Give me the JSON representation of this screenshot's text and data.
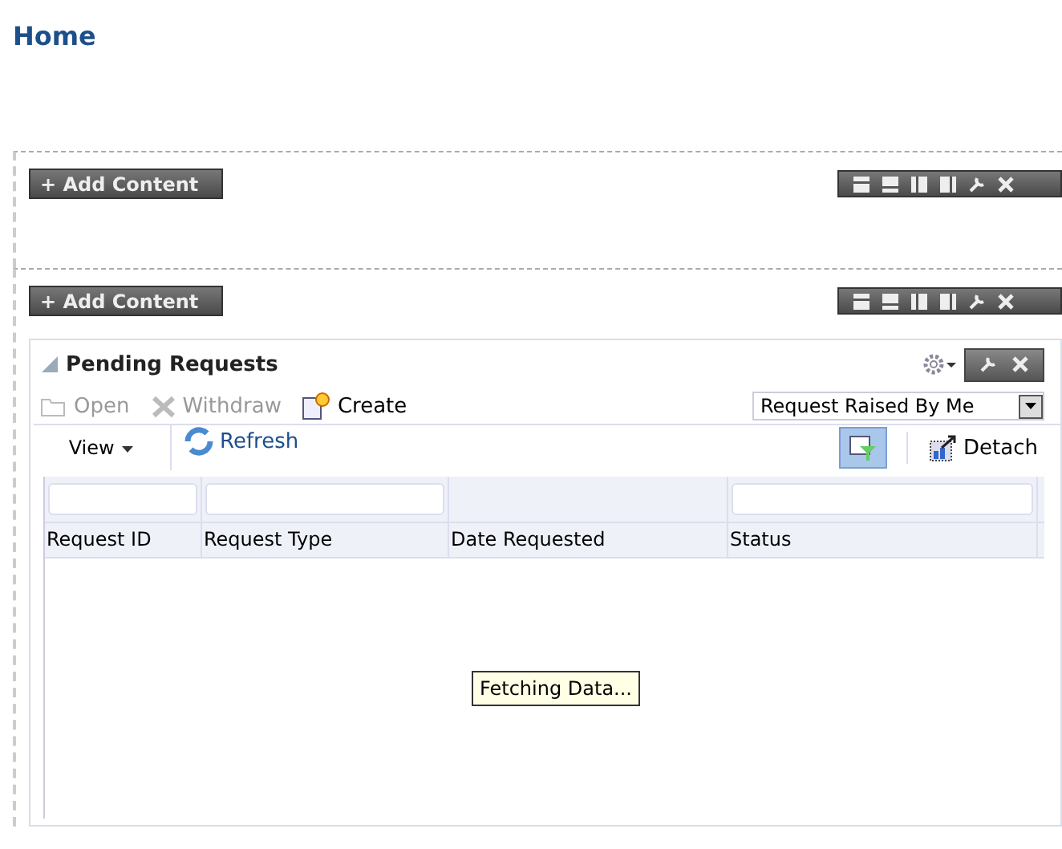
{
  "page": {
    "title": "Home"
  },
  "regions": [
    {
      "add_label": "+ Add Content"
    },
    {
      "add_label": "+ Add Content",
      "panel": {
        "title": "Pending Requests",
        "actions": [
          {
            "label": "Open",
            "kind": "open",
            "disabled": true
          },
          {
            "label": "Withdraw",
            "kind": "withdraw",
            "disabled": true
          },
          {
            "label": "Create",
            "kind": "create",
            "disabled": false
          }
        ],
        "filter_select": {
          "value": "Request Raised By Me"
        },
        "view_menu": "View",
        "refresh": "Refresh",
        "detach": "Detach",
        "query_by_example": {
          "selected": true
        },
        "columns": [
          {
            "label": "Request ID",
            "filterable": true
          },
          {
            "label": "Request Type",
            "filterable": true
          },
          {
            "label": "Date Requested",
            "filterable": false
          },
          {
            "label": "Status",
            "filterable": true
          }
        ],
        "status_message": "Fetching Data..."
      }
    }
  ]
}
